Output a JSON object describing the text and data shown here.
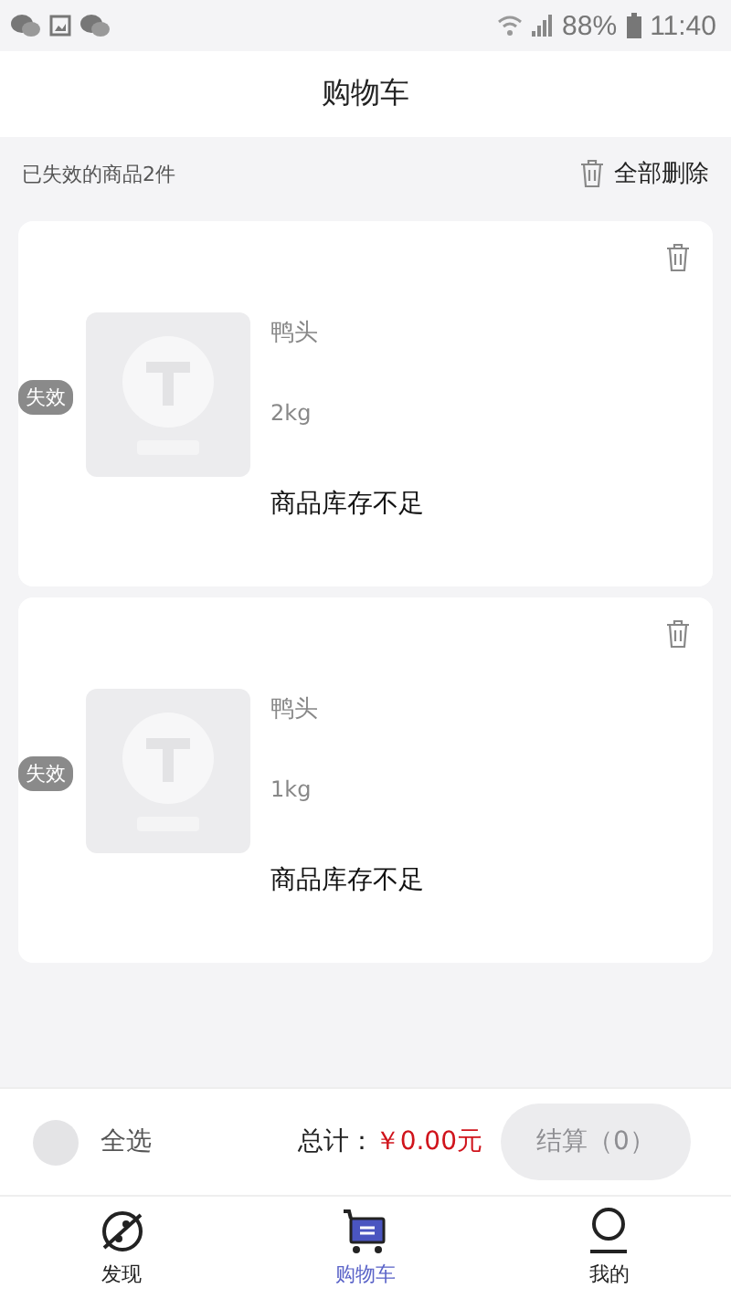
{
  "status_bar": {
    "battery": "88%",
    "time": "11:40"
  },
  "header": {
    "title": "购物车"
  },
  "invalid_bar": {
    "summary": "已失效的商品2件",
    "delete_all": "全部删除"
  },
  "items": [
    {
      "badge": "失效",
      "name": "鸭头",
      "spec": "2kg",
      "reason": "商品库存不足"
    },
    {
      "badge": "失效",
      "name": "鸭头",
      "spec": "1kg",
      "reason": "商品库存不足"
    }
  ],
  "footer": {
    "select_all": {
      "label": "全选",
      "checked": false
    },
    "total_label": "总计：",
    "total": "￥0.00元",
    "checkout": {
      "label": "结算（0）",
      "disabled": true
    }
  },
  "tabs": [
    {
      "kind": "discover",
      "label": "发现",
      "selected": false
    },
    {
      "kind": "cart",
      "label": "购物车",
      "selected": true
    },
    {
      "kind": "me",
      "label": "我的",
      "selected": false
    }
  ]
}
